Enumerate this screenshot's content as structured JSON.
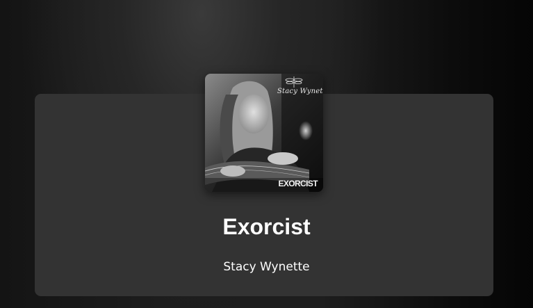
{
  "track": {
    "title": "Exorcist",
    "artist": "Stacy Wynette"
  },
  "cover": {
    "signature_text": "Stacy Wynette",
    "title_text": "EXORCIST"
  },
  "colors": {
    "card": "#333333",
    "text": "#ffffff",
    "background": "#1a1a1a"
  }
}
